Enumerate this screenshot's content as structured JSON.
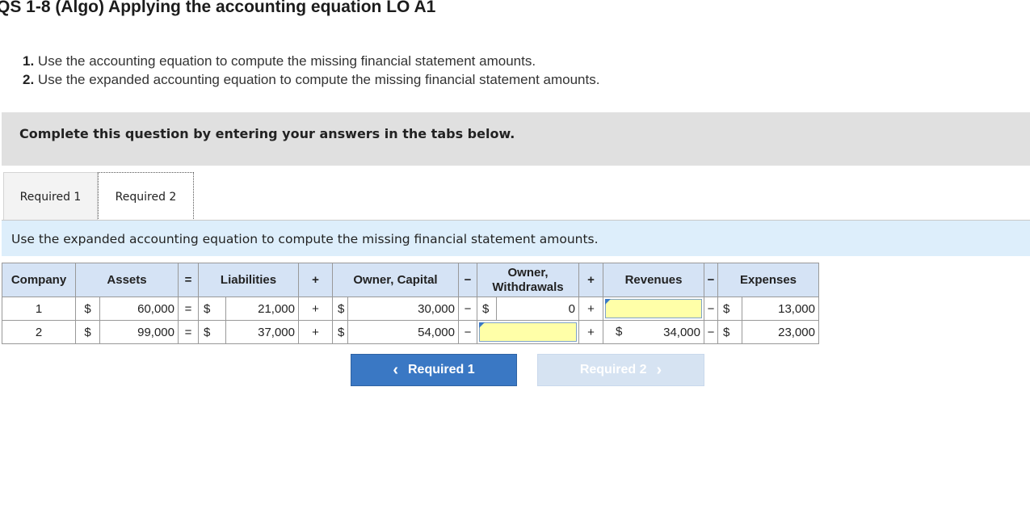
{
  "title": "QS 1-8 (Algo) Applying the accounting equation LO A1",
  "instructions": [
    {
      "num": "1.",
      "text": "Use the accounting equation to compute the missing financial statement amounts."
    },
    {
      "num": "2.",
      "text": "Use the expanded accounting equation to compute the missing financial statement amounts."
    }
  ],
  "banner": "Complete this question by entering your answers in the tabs below.",
  "tabs": [
    "Required 1",
    "Required 2"
  ],
  "subtitle": "Use the expanded accounting equation to compute the missing financial statement amounts.",
  "table": {
    "headers": {
      "company": "Company",
      "assets": "Assets",
      "eq": "=",
      "liabilities": "Liabilities",
      "plus1": "+",
      "capital": "Owner, Capital",
      "minus1": "−",
      "withdrawals_line1": "Owner,",
      "withdrawals_line2": "Withdrawals",
      "plus2": "+",
      "revenues": "Revenues",
      "minus2": "−",
      "expenses": "Expenses"
    },
    "currency": "$",
    "rows": [
      {
        "company": "1",
        "assets": "60,000",
        "eq": "=",
        "liabilities": "21,000",
        "plus1": "+",
        "capital": "30,000",
        "minus1": "−",
        "withdrawals": "0",
        "plus2": "+",
        "revenues": "",
        "minus2": "−",
        "expenses": "13,000"
      },
      {
        "company": "2",
        "assets": "99,000",
        "eq": "=",
        "liabilities": "37,000",
        "plus1": "+",
        "capital": "54,000",
        "minus1": "−",
        "withdrawals": "",
        "plus2": "+",
        "revenues": "34,000",
        "minus2": "−",
        "expenses": "23,000"
      }
    ]
  },
  "nav": {
    "prev_label": "Required 1",
    "next_label": "Required 2",
    "prev_icon": "‹",
    "next_icon": "›"
  },
  "colors": {
    "input_bg": "#ffffa8",
    "header_bg": "#d5e3f5",
    "primary_button": "#3a78c4",
    "disabled_button": "#d6e3f2"
  }
}
